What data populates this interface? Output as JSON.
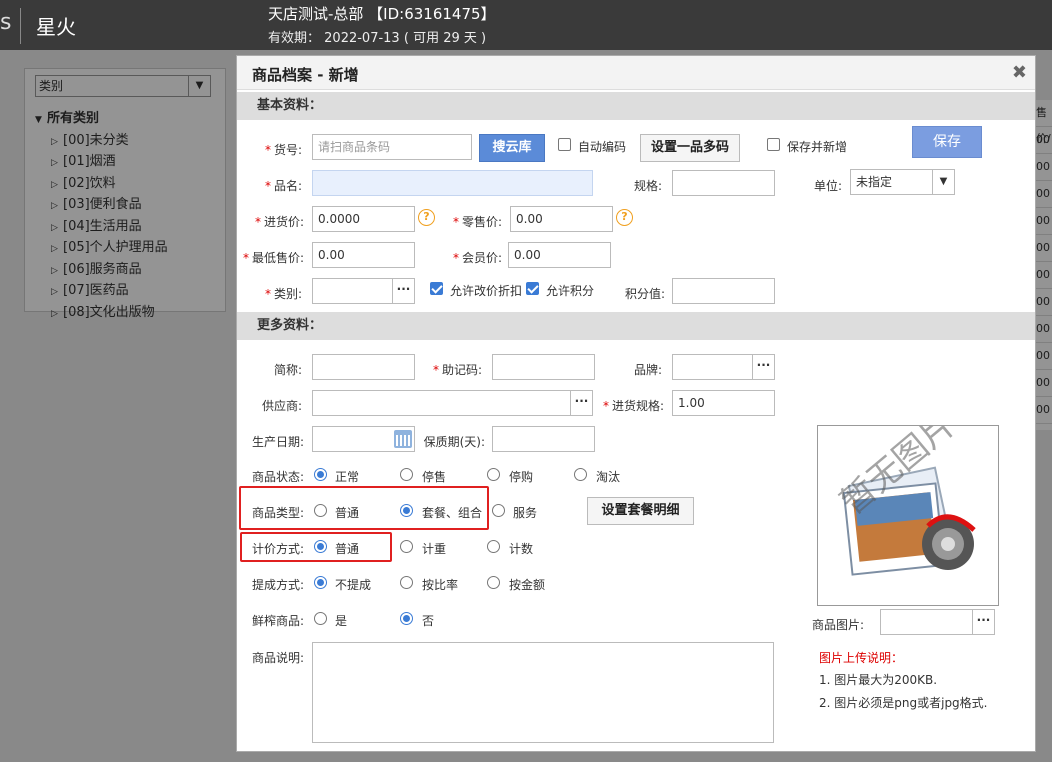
{
  "header": {
    "edge_glyph": "s",
    "app_name": "星火",
    "store_title": "天店测试-总部 【ID:63161475】",
    "valid_label": "有效期：",
    "valid_date": "2022-07-13",
    "valid_remaining": "( 可用 29 天 )"
  },
  "category_panel": {
    "select_value": "类别",
    "root": "所有类别",
    "items": [
      "[00]未分类",
      "[01]烟酒",
      "[02]饮料",
      "[03]便利食品",
      "[04]生活用品",
      "[05]个人护理用品",
      "[06]服务商品",
      "[07]医药品",
      "[08]文化出版物"
    ]
  },
  "right_edge": {
    "header": "售价/",
    "values": [
      "00",
      "00",
      "00",
      "00",
      "00",
      "00",
      "00",
      "00",
      "00",
      "00",
      "00"
    ]
  },
  "dialog": {
    "title": "商品档案 - 新增",
    "close_glyph": "✖",
    "sections": {
      "basic": "基本资料：",
      "more": "更多资料："
    },
    "basic": {
      "sku_label": "货号:",
      "sku_placeholder": "请扫商品条码",
      "search_cloud_btn": "搜云库",
      "auto_code_label": "自动编码",
      "auto_code_checked": false,
      "multi_code_btn": "设置一品多码",
      "save_and_new_label": "保存并新增",
      "save_and_new_checked": false,
      "save_btn": "保存",
      "name_label": "品名:",
      "name_value": "",
      "spec_label": "规格:",
      "spec_value": "",
      "unit_label": "单位:",
      "unit_value": "未指定",
      "cost_label": "进货价:",
      "cost_value": "0.0000",
      "retail_label": "零售价:",
      "retail_value": "0.00",
      "min_price_label": "最低售价:",
      "min_price_value": "0.00",
      "member_price_label": "会员价:",
      "member_price_value": "0.00",
      "category_label": "类别:",
      "category_value": "",
      "allow_discount_label": "允许改价折扣",
      "allow_discount_checked": true,
      "allow_points_label": "允许积分",
      "allow_points_checked": true,
      "points_label": "积分值:",
      "points_value": ""
    },
    "more": {
      "abbr_label": "简称:",
      "mnemonic_label": "助记码:",
      "brand_label": "品牌:",
      "supplier_label": "供应商:",
      "purchase_spec_label": "进货规格:",
      "purchase_spec_value": "1.00",
      "prod_date_label": "生产日期:",
      "shelf_life_label": "保质期(天):",
      "status_label": "商品状态:",
      "status_options": [
        "正常",
        "停售",
        "停购",
        "淘汰"
      ],
      "status_selected": "正常",
      "type_label": "商品类型:",
      "type_options": [
        "普通",
        "套餐、组合",
        "服务"
      ],
      "type_selected": "套餐、组合",
      "combo_btn": "设置套餐明细",
      "pricing_label": "计价方式:",
      "pricing_options": [
        "普通",
        "计重",
        "计数"
      ],
      "pricing_selected": "普通",
      "commission_label": "提成方式:",
      "commission_options": [
        "不提成",
        "按比率",
        "按金额"
      ],
      "commission_selected": "不提成",
      "fresh_label": "鲜榨商品:",
      "fresh_options": [
        "是",
        "否"
      ],
      "fresh_selected": "否",
      "desc_label": "商品说明:",
      "image_placeholder_text": "暂无图片",
      "image_label": "商品图片:",
      "upload_title": "图片上传说明：",
      "upload_note1": "1. 图片最大为200KB.",
      "upload_note2": "2. 图片必须是png或者jpg格式."
    }
  },
  "colors": {
    "accent": "#3a7bd5",
    "required": "#dd0000",
    "highlight_box": "#e02020",
    "primary_btn": "#5b8bd8"
  }
}
